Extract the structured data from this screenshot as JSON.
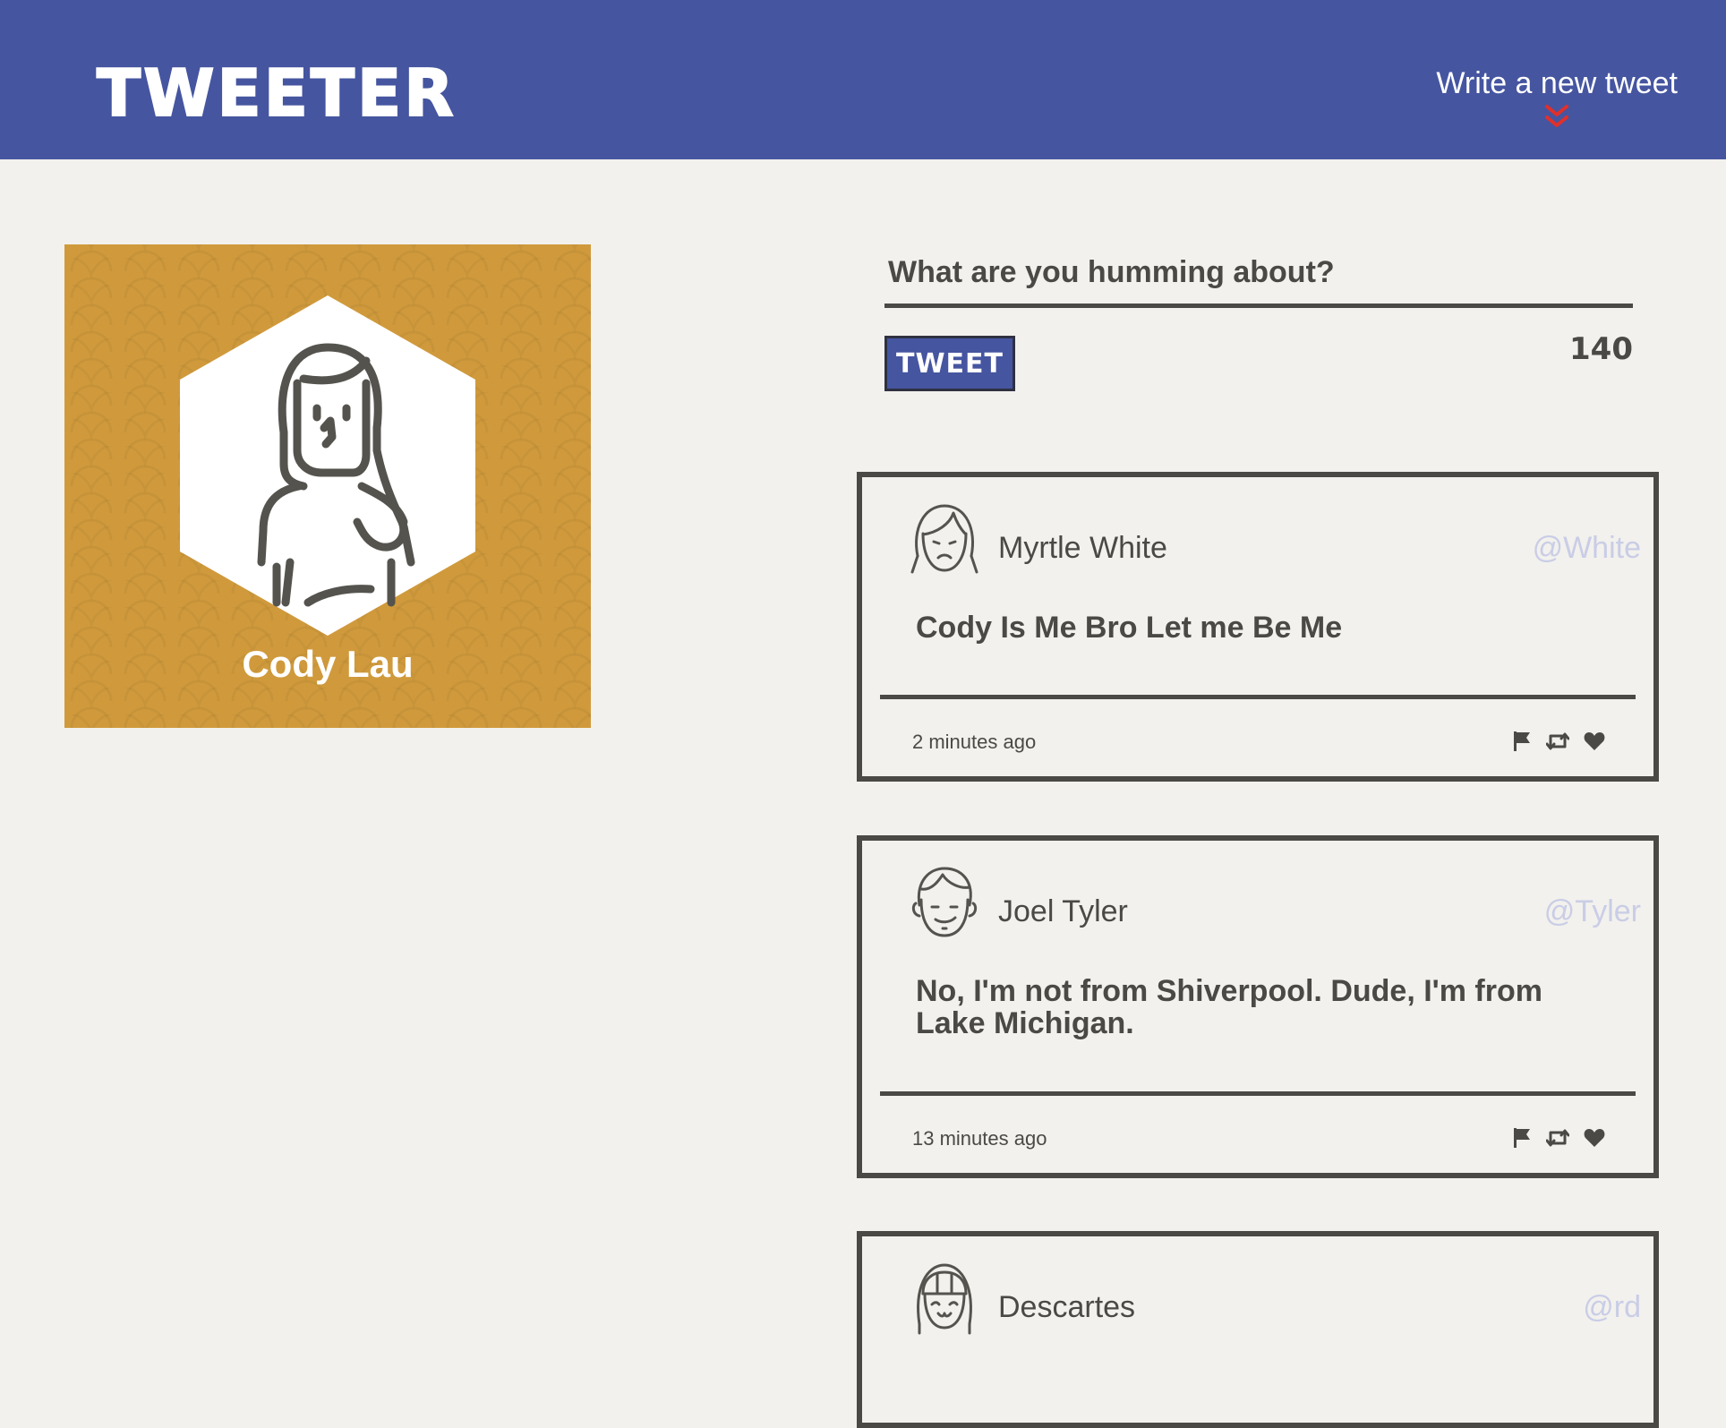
{
  "header": {
    "brand": "TWEETER",
    "compose_label": "Write a new tweet"
  },
  "profile": {
    "name": "Cody Lau"
  },
  "composer": {
    "placeholder": "What are you humming about?",
    "button_label": "TWEET",
    "char_count": "140"
  },
  "tweets": [
    {
      "name": "Myrtle White",
      "handle": "@White",
      "text": "Cody Is Me Bro Let me Be Me",
      "time": "2 minutes ago",
      "avatar": "woman-frown-avatar"
    },
    {
      "name": "Joel Tyler",
      "handle": "@Tyler",
      "text": "No, I'm not from Shiverpool. Dude, I'm from Lake Michigan.",
      "time": "13 minutes ago",
      "avatar": "man-smirk-avatar"
    },
    {
      "name": "Descartes",
      "handle": "@rd",
      "text": "",
      "time": "",
      "avatar": "girl-bangs-avatar"
    }
  ],
  "colors": {
    "nav": "#4555a0",
    "background": "#f2f1ed",
    "profile_card": "#d09a3c",
    "text": "#4a4945",
    "handle": "#c9cde6",
    "chevron": "#e0302c"
  },
  "icons": [
    "chevron-double-down-icon",
    "flag-icon",
    "retweet-icon",
    "heart-icon"
  ]
}
